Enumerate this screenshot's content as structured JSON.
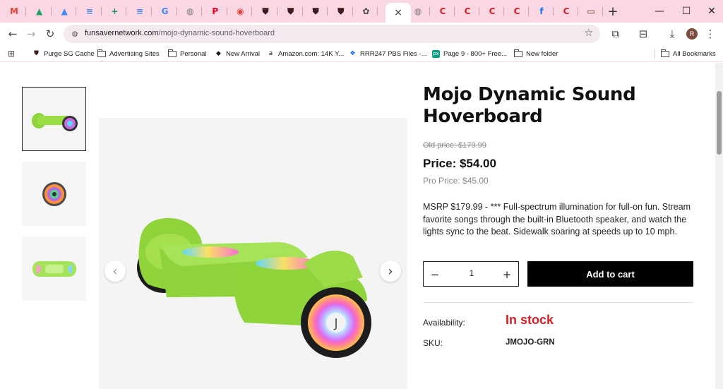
{
  "browser": {
    "tabs": [
      {
        "icon": "gmail-icon",
        "glyph": "M",
        "color": "#ea4335"
      },
      {
        "icon": "google-drive-icon",
        "glyph": "▲",
        "color": "#1fa463"
      },
      {
        "icon": "google-drive-icon",
        "glyph": "▲",
        "color": "#4285f4"
      },
      {
        "icon": "google-docs-icon",
        "glyph": "≡",
        "color": "#4285f4"
      },
      {
        "icon": "google-sheets-icon",
        "glyph": "+",
        "color": "#0f9d58"
      },
      {
        "icon": "google-docs-icon",
        "glyph": "≡",
        "color": "#4285f4"
      },
      {
        "icon": "google-icon",
        "glyph": "G",
        "color": "#4285f4"
      },
      {
        "icon": "globe-icon",
        "glyph": "◍",
        "color": "#777777"
      },
      {
        "icon": "pinterest-icon",
        "glyph": "P",
        "color": "#e60023"
      },
      {
        "icon": "chrome-icon",
        "glyph": "◉",
        "color": "#db4437"
      },
      {
        "icon": "shield-icon",
        "glyph": "⛊",
        "color": "#3b1d1d"
      },
      {
        "icon": "shield-icon",
        "glyph": "⛊",
        "color": "#3b1d1d"
      },
      {
        "icon": "shield-icon",
        "glyph": "⛊",
        "color": "#3b1d1d"
      },
      {
        "icon": "shield-icon",
        "glyph": "⛊",
        "color": "#3b1d1d"
      },
      {
        "icon": "openai-icon",
        "glyph": "✿",
        "color": "#444444"
      }
    ],
    "tabs_after": [
      {
        "icon": "globe-icon",
        "glyph": "◍",
        "color": "#777777"
      },
      {
        "icon": "c-logo-icon",
        "glyph": "C",
        "color": "#d21f26"
      },
      {
        "icon": "c-logo-icon",
        "glyph": "C",
        "color": "#d21f26"
      },
      {
        "icon": "c-logo-icon",
        "glyph": "C",
        "color": "#d21f26"
      },
      {
        "icon": "c-logo-icon",
        "glyph": "C",
        "color": "#d21f26"
      },
      {
        "icon": "facebook-icon",
        "glyph": "f",
        "color": "#1877f2"
      },
      {
        "icon": "c-logo-icon",
        "glyph": "C",
        "color": "#d21f26"
      },
      {
        "icon": "hdd-icon",
        "glyph": "▭",
        "color": "#4a3b1e"
      }
    ],
    "active_tab_close": "×",
    "new_tab": "+",
    "url_host": "funsavernetwork.com",
    "url_path": "/mojo-dynamic-sound-hoverboard",
    "avatar_initial": "R",
    "bookmarks": [
      {
        "label": "Purge SG Cache",
        "icon": "shield-icon"
      },
      {
        "label": "Advertising Sites",
        "icon": "folder-icon"
      },
      {
        "label": "Personal",
        "icon": "folder-icon"
      },
      {
        "label": "New Arrival",
        "icon": "diamond-icon"
      },
      {
        "label": "Amazon.com: 14K Y...",
        "icon": "amazon-icon"
      },
      {
        "label": "RRR247 PBS Files -...",
        "icon": "dropbox-icon"
      },
      {
        "label": "Page 9 - 800+ Free...",
        "icon": "pexels-icon"
      },
      {
        "label": "New folder",
        "icon": "folder-icon"
      }
    ],
    "all_bookmarks": "All Bookmarks"
  },
  "product": {
    "title": "Mojo Dynamic Sound Hoverboard",
    "old_price": "Old price: $179.99",
    "price": "Price: $54.00",
    "pro_price": "Pro Price: $45.00",
    "description": "MSRP $179.99 - *** Full-spectrum illumination for full-on fun. Stream favorite songs through the built-in Bluetooth speaker, and watch the lights sync to the beat. Sidewalk soaring at speeds up to 10 mph.",
    "quantity": "1",
    "add_to_cart": "Add to cart",
    "availability_label": "Availability:",
    "availability_value": "In stock",
    "sku_label": "SKU:",
    "sku_value": "JMOJO-GRN"
  },
  "colors": {
    "tabstrip": "#fbd6e3",
    "in_stock": "#d61f26",
    "hoverboard_green": "#8fd43a"
  }
}
